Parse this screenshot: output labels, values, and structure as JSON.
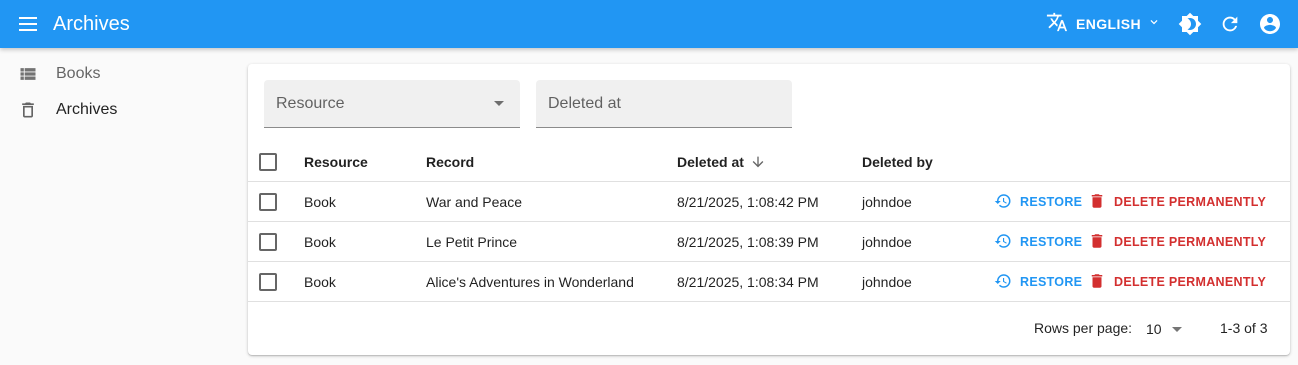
{
  "app": {
    "title": "Archives",
    "language_label": "ENGLISH"
  },
  "sidebar": {
    "items": [
      {
        "label": "Books",
        "icon": "list-icon"
      },
      {
        "label": "Archives",
        "icon": "trash-icon"
      }
    ]
  },
  "filters": {
    "resource_placeholder": "Resource",
    "deleted_at_placeholder": "Deleted at"
  },
  "table": {
    "columns": {
      "resource": "Resource",
      "record": "Record",
      "deleted_at": "Deleted at",
      "deleted_by": "Deleted by"
    },
    "sort": {
      "column": "deleted_at",
      "direction": "desc"
    },
    "rows": [
      {
        "resource": "Book",
        "record": "War and Peace",
        "deleted_at": "8/21/2025, 1:08:42 PM",
        "deleted_by": "johndoe"
      },
      {
        "resource": "Book",
        "record": "Le Petit Prince",
        "deleted_at": "8/21/2025, 1:08:39 PM",
        "deleted_by": "johndoe"
      },
      {
        "resource": "Book",
        "record": "Alice's Adventures in Wonderland",
        "deleted_at": "8/21/2025, 1:08:34 PM",
        "deleted_by": "johndoe"
      }
    ],
    "actions": {
      "restore_label": "RESTORE",
      "delete_label": "DELETE PERMANENTLY"
    }
  },
  "pagination": {
    "rows_per_page_label": "Rows per page:",
    "rows_per_page_value": "10",
    "range_label": "1-3 of 3"
  },
  "colors": {
    "primary": "#2196f3",
    "danger": "#d32f2f"
  }
}
